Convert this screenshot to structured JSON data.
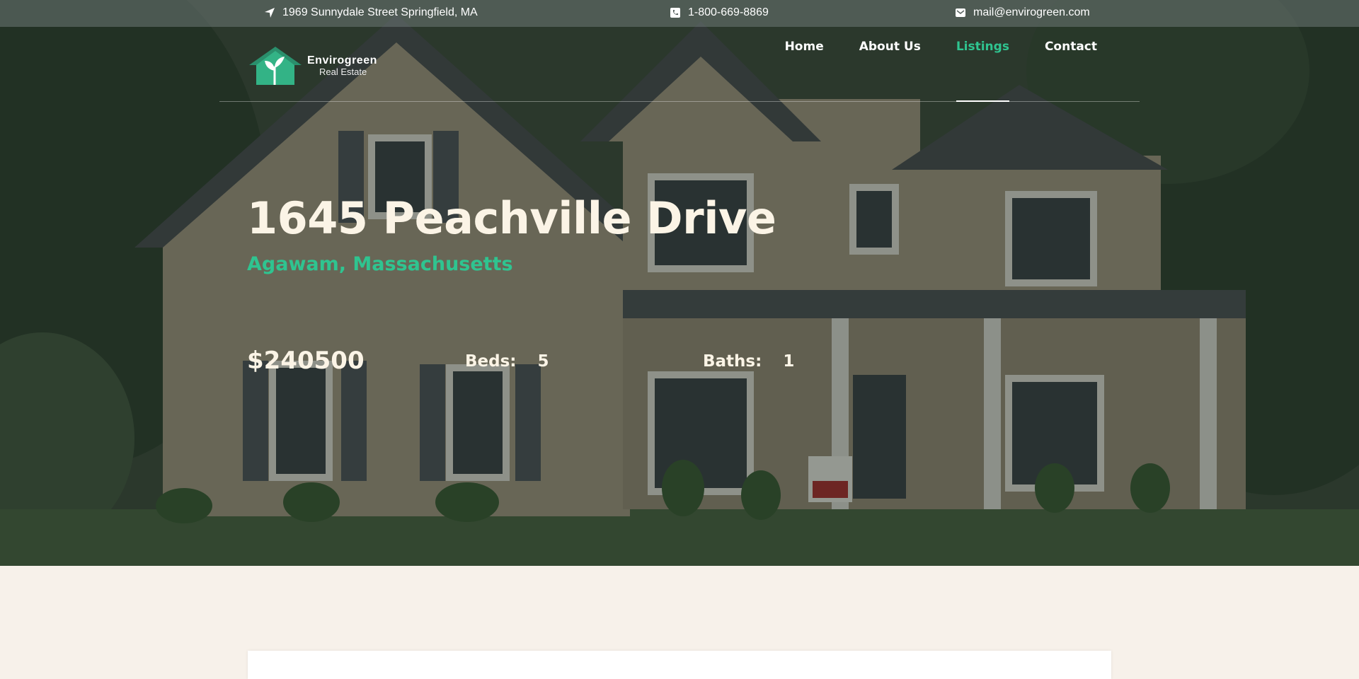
{
  "topbar": {
    "address": "1969 Sunnydale Street Springfield, MA",
    "phone": "1-800-669-8869",
    "email": "mail@envirogreen.com"
  },
  "brand": {
    "name": "Envirogreen",
    "tagline": "Real Estate",
    "accent": "#2fc490"
  },
  "nav": {
    "items": [
      {
        "label": "Home"
      },
      {
        "label": "About Us"
      },
      {
        "label": "Listings"
      },
      {
        "label": "Contact"
      }
    ],
    "active": "Listings"
  },
  "listing": {
    "street": "1645 Peachville Drive",
    "location": "Agawam, Massachusetts",
    "price": "$240500",
    "beds_label": "Beds:",
    "beds": "5",
    "baths_label": "Baths:",
    "baths": "1"
  }
}
